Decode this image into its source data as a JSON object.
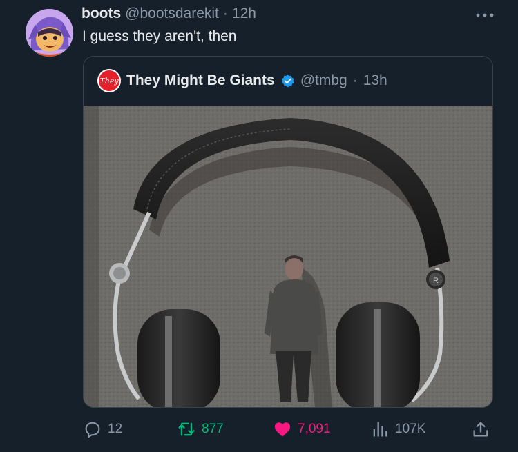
{
  "tweet": {
    "display_name": "boots",
    "handle": "@bootsdarekit",
    "separator": "·",
    "time": "12h",
    "text": "I guess they aren't, then",
    "more_icon": "more-horizontal-icon"
  },
  "quoted_tweet": {
    "avatar_text": "They",
    "display_name": "They Might Be Giants",
    "verified": true,
    "handle": "@tmbg",
    "separator": "·",
    "time": "13h"
  },
  "actions": {
    "reply_count": "12",
    "retweet_count": "877",
    "like_count": "7,091",
    "view_count": "107K",
    "like_active": true
  },
  "photo_labels": {
    "headphone_cup_letter": "R"
  },
  "colors": {
    "background": "#15202b",
    "text": "#e7e9ea",
    "muted": "#8b98a5",
    "border": "#38444d",
    "retweet": "#00ba7c",
    "like": "#f91880",
    "verified": "#1d9bf0"
  }
}
